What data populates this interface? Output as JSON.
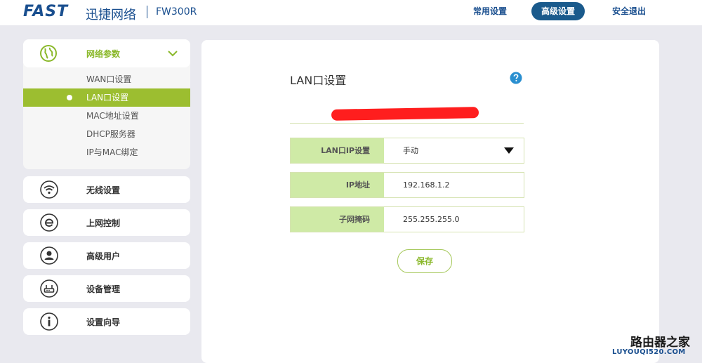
{
  "header": {
    "brand": "FAST",
    "brand_cn": "迅捷网络",
    "model": "FW300R",
    "nav": {
      "basic": "常用设置",
      "advanced": "高级设置",
      "logout": "安全退出"
    }
  },
  "sidebar": {
    "network_group": {
      "title": "网络参数",
      "icon": "globe-icon",
      "items": [
        {
          "label": "WAN口设置"
        },
        {
          "label": "LAN口设置",
          "active": true
        },
        {
          "label": "MAC地址设置"
        },
        {
          "label": "DHCP服务器"
        },
        {
          "label": "IP与MAC绑定"
        }
      ]
    },
    "menu": [
      {
        "label": "无线设置",
        "icon": "wifi-icon"
      },
      {
        "label": "上网控制",
        "icon": "internet-icon"
      },
      {
        "label": "高级用户",
        "icon": "user-icon"
      },
      {
        "label": "设备管理",
        "icon": "router-icon"
      },
      {
        "label": "设置向导",
        "icon": "info-icon"
      }
    ]
  },
  "main": {
    "title": "LAN口设置",
    "form": {
      "ip_mode_label": "LAN口IP设置",
      "ip_mode_value": "手动",
      "ip_label": "IP地址",
      "ip_value": "192.168.1.2",
      "mask_label": "子网掩码",
      "mask_value": "255.255.255.0"
    },
    "save_label": "保存"
  },
  "watermark": {
    "cn": "路由器之家",
    "url": "LUYOUQI520.COM"
  },
  "colors": {
    "brand_blue": "#1a4f8f",
    "accent_green": "#9cbe30",
    "label_bg": "#cfeaa6",
    "redaction": "#ff1e1e"
  }
}
